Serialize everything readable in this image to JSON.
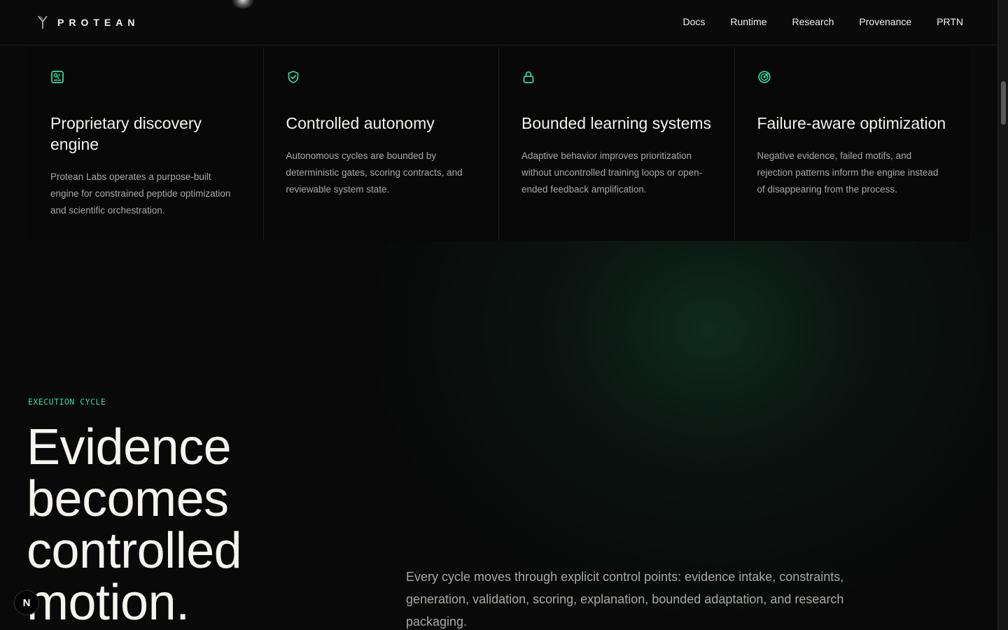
{
  "colors": {
    "background": "#090909",
    "accent": "#2fe0a0",
    "text": "#f2f2ee",
    "muted": "#a9a9a4"
  },
  "header": {
    "brand": "PROTEAN",
    "nav": [
      {
        "label": "Docs"
      },
      {
        "label": "Runtime"
      },
      {
        "label": "Research"
      },
      {
        "label": "Provenance"
      },
      {
        "label": "PRTN"
      }
    ]
  },
  "features": [
    {
      "icon": "discovery-engine-icon",
      "title": "Proprietary discovery engine",
      "body": "Protean Labs operates a purpose-built engine for constrained peptide optimization and scientific orchestration."
    },
    {
      "icon": "shield-check-icon",
      "title": "Controlled autonomy",
      "body": "Autonomous cycles are bounded by deterministic gates, scoring contracts, and reviewable system state."
    },
    {
      "icon": "lock-icon",
      "title": "Bounded learning systems",
      "body": "Adaptive behavior improves prioritization without uncontrolled training loops or open-ended feedback amplification."
    },
    {
      "icon": "radar-target-icon",
      "title": "Failure-aware optimization",
      "body": "Negative evidence, failed motifs, and rejection patterns inform the engine instead of disappearing from the process."
    }
  ],
  "execution": {
    "eyebrow": "EXECUTION CYCLE",
    "headline": "Evidence becomes controlled motion.",
    "body": "Every cycle moves through explicit control points: evidence intake, constraints, generation, validation, scoring, explanation, bounded adaptation, and research packaging."
  },
  "badge": {
    "letter": "N"
  }
}
